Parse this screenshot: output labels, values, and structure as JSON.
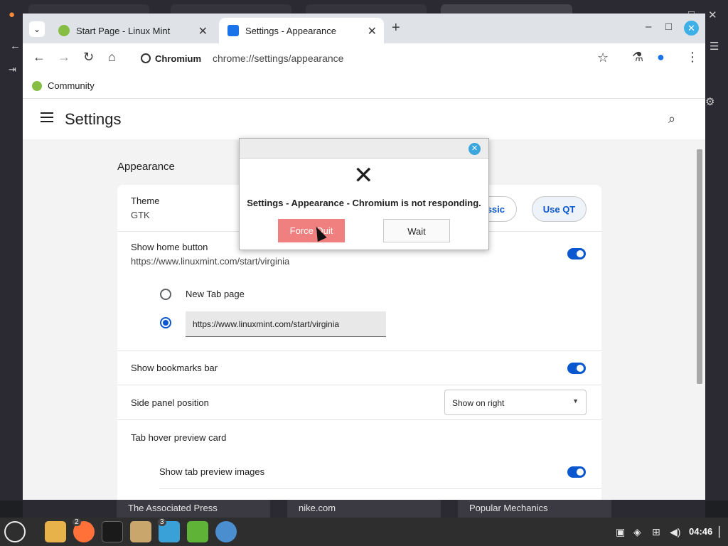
{
  "browser": {
    "tabs": [
      {
        "title": "Start Page - Linux Mint",
        "icon": "mint-icon"
      },
      {
        "title": "Settings - Appearance",
        "icon": "gear-icon"
      }
    ],
    "origin_chip": "Chromium",
    "url": "chrome://settings/appearance",
    "bookmarks": [
      {
        "label": "Community"
      }
    ]
  },
  "settings": {
    "title": "Settings",
    "section": "Appearance",
    "theme": {
      "label": "Theme",
      "value": "GTK",
      "classic_label": "ssic",
      "qt_label": "Use QT"
    },
    "home_button": {
      "label": "Show home button",
      "value": "https://www.linuxmint.com/start/virginia",
      "enabled": true,
      "option_newtab": "New Tab page",
      "custom_url": "https://www.linuxmint.com/start/virginia"
    },
    "bookmarks_bar": {
      "label": "Show bookmarks bar",
      "enabled": true
    },
    "side_panel": {
      "label": "Side panel position",
      "value": "Show on right"
    },
    "tab_hover": {
      "label": "Tab hover preview card"
    },
    "tab_preview": {
      "label": "Show tab preview images",
      "enabled": true
    }
  },
  "dialog": {
    "message": "Settings - Appearance - Chromium is not responding.",
    "force_quit": "Force Quit",
    "wait": "Wait"
  },
  "background_window": {
    "shortcuts": [
      "The Associated Press",
      "nike.com",
      "Popular Mechanics"
    ]
  },
  "taskbar": {
    "firefox_badge": "2",
    "monitor_badge": "3",
    "clock": "04:46"
  }
}
